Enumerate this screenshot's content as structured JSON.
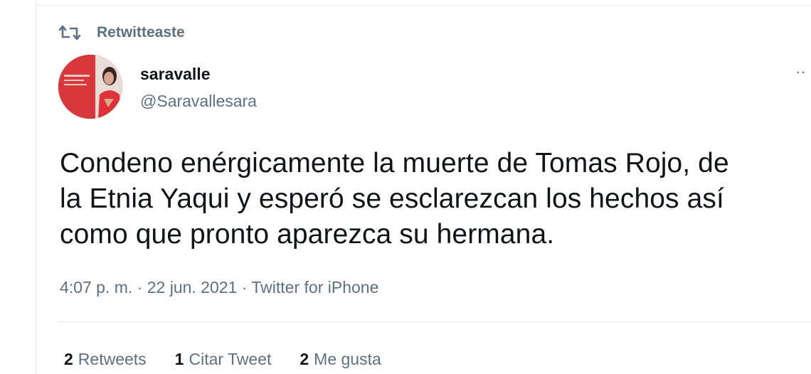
{
  "social_context": {
    "icon": "retweet-icon",
    "label": "Retwitteaste"
  },
  "author": {
    "display_name": "saravalle",
    "handle": "@Saravallesara",
    "avatar": "profile-avatar"
  },
  "more_menu": {
    "icon": "more-icon",
    "label": "··"
  },
  "tweet": {
    "text": "Condeno enérgicamente la muerte de Tomas Rojo, de\nla Etnia Yaqui y esperó se esclarezcan los hechos así\ncomo que pronto aparezca su hermana.",
    "time": "4:07 p. m.",
    "separator": " · ",
    "date": "22 jun. 2021",
    "source": "Twitter for iPhone"
  },
  "stats": {
    "retweets": {
      "count": "2",
      "label": "Retweets"
    },
    "quotes": {
      "count": "1",
      "label": "Citar Tweet"
    },
    "likes": {
      "count": "2",
      "label": "Me gusta"
    }
  },
  "colors": {
    "text_primary": "#0f1419",
    "text_secondary": "#5b7083",
    "divider": "#e6ecf0",
    "avatar_red": "#b8282e"
  }
}
